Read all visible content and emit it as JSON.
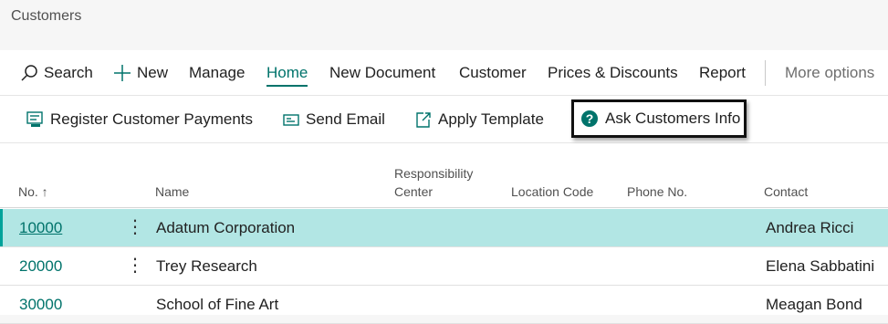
{
  "page": {
    "title": "Customers"
  },
  "actionbar": {
    "search": "Search",
    "new": "New",
    "manage": "Manage",
    "home": "Home",
    "new_document": "New Document",
    "customer": "Customer",
    "prices_discounts": "Prices & Discounts",
    "report": "Report",
    "more_options": "More options"
  },
  "promoted": {
    "register_payments": "Register Customer Payments",
    "send_email": "Send Email",
    "apply_template": "Apply Template",
    "ask_info": "Ask Customers Info"
  },
  "table": {
    "headers": {
      "no": "No. ↑",
      "name": "Name",
      "resp_line1": "Responsibility",
      "resp_line2": "Center",
      "location": "Location Code",
      "phone": "Phone No.",
      "contact": "Contact"
    },
    "rows": [
      {
        "no": "10000",
        "name": "Adatum Corporation",
        "contact": "Andrea Ricci",
        "menu": "⋮"
      },
      {
        "no": "20000",
        "name": "Trey Research",
        "contact": "Elena Sabbatini",
        "menu": "⋮"
      },
      {
        "no": "30000",
        "name": "School of Fine Art",
        "contact": "Meagan Bond",
        "menu": ""
      }
    ]
  },
  "colors": {
    "accent": "#00736b",
    "selected_row": "#b2e6e4"
  }
}
